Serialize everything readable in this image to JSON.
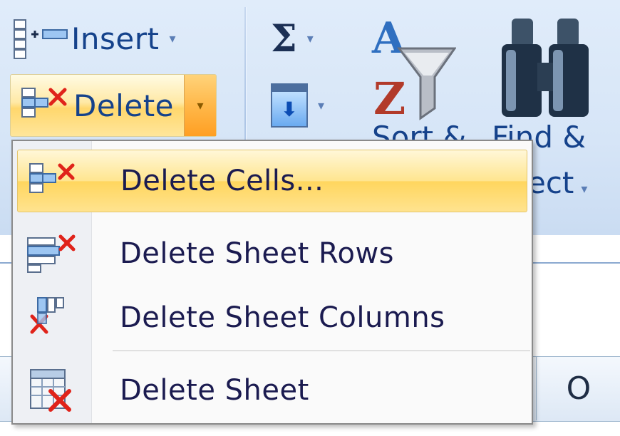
{
  "ribbon": {
    "insert_label": "Insert",
    "delete_label": "Delete",
    "sort_label": "Sort &",
    "find_label": "Find &",
    "select_label": "ect",
    "sum_glyph": "Σ",
    "dropdown_arrow": "▾"
  },
  "sheet": {
    "column_header": "O"
  },
  "menu": {
    "items": [
      {
        "label": "Delete Cells...",
        "icon": "delete-cells-icon",
        "highlighted": true
      },
      {
        "label": "Delete Sheet Rows",
        "icon": "delete-rows-icon"
      },
      {
        "label": "Delete Sheet Columns",
        "icon": "delete-columns-icon"
      },
      {
        "label": "Delete Sheet",
        "icon": "delete-sheet-icon"
      }
    ]
  },
  "colors": {
    "ribbon_text": "#15428b",
    "menu_text": "#1b1b50",
    "highlight": "#ffd65e",
    "delete_x": "#e0231a"
  }
}
